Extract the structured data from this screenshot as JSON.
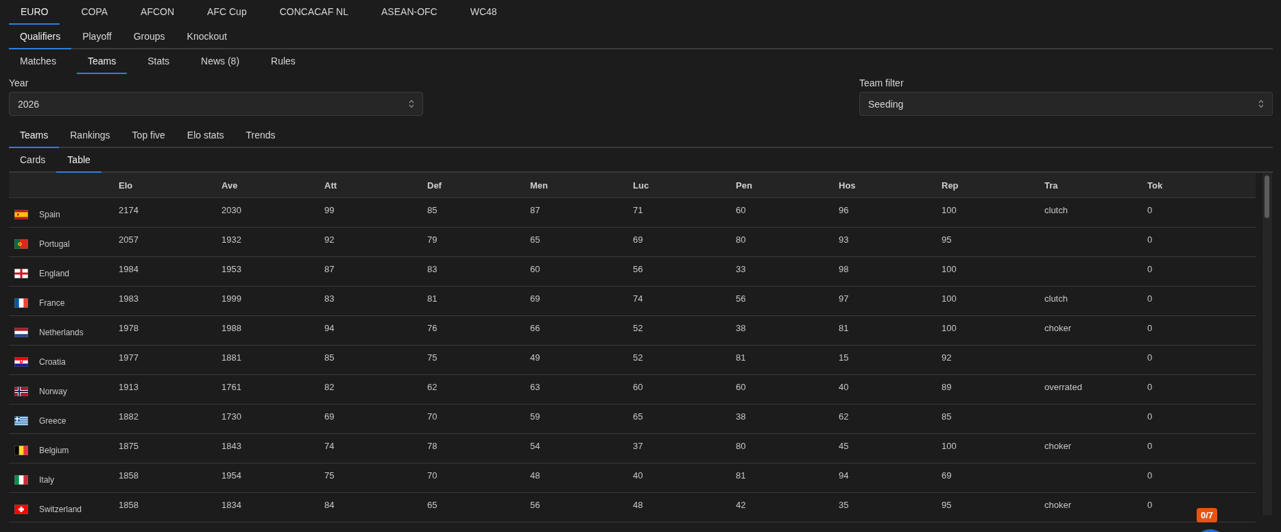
{
  "competition_tabs": [
    {
      "label": "EURO",
      "selected": true
    },
    {
      "label": "COPA",
      "selected": false
    },
    {
      "label": "AFCON",
      "selected": false
    },
    {
      "label": "AFC Cup",
      "selected": false
    },
    {
      "label": "CONCACAF NL",
      "selected": false
    },
    {
      "label": "ASEAN-OFC",
      "selected": false
    },
    {
      "label": "WC48",
      "selected": false
    }
  ],
  "stage_tabs": [
    {
      "label": "Qualifiers",
      "selected": true
    },
    {
      "label": "Playoff",
      "selected": false
    },
    {
      "label": "Groups",
      "selected": false
    },
    {
      "label": "Knockout",
      "selected": false
    }
  ],
  "section_tabs": [
    {
      "label": "Matches",
      "selected": false
    },
    {
      "label": "Teams",
      "selected": true
    },
    {
      "label": "Stats",
      "selected": false
    },
    {
      "label": "News (8)",
      "selected": false
    },
    {
      "label": "Rules",
      "selected": false
    }
  ],
  "filters": [
    {
      "label": "Year",
      "value": "2026"
    },
    {
      "label": "Team filter",
      "value": "Seeding"
    }
  ],
  "view_tabs": [
    {
      "label": "Teams",
      "selected": true
    },
    {
      "label": "Rankings",
      "selected": false
    },
    {
      "label": "Top five",
      "selected": false
    },
    {
      "label": "Elo stats",
      "selected": false
    },
    {
      "label": "Trends",
      "selected": false
    }
  ],
  "display_tabs": [
    {
      "label": "Cards",
      "selected": false
    },
    {
      "label": "Table",
      "selected": true
    }
  ],
  "table": {
    "columns": [
      "Elo",
      "Ave",
      "Att",
      "Def",
      "Men",
      "Luc",
      "Pen",
      "Hos",
      "Rep",
      "Tra",
      "Tok"
    ],
    "rows": [
      {
        "flag": {
          "kind": "es"
        },
        "team": "Spain",
        "cells": [
          "2174",
          "2030",
          "99",
          "85",
          "87",
          "71",
          "60",
          "96",
          "100",
          "clutch",
          "0"
        ]
      },
      {
        "flag": {
          "kind": "pt"
        },
        "team": "Portugal",
        "cells": [
          "2057",
          "1932",
          "92",
          "79",
          "65",
          "69",
          "80",
          "93",
          "95",
          "",
          "0"
        ]
      },
      {
        "flag": {
          "kind": "en"
        },
        "team": "England",
        "cells": [
          "1984",
          "1953",
          "87",
          "83",
          "60",
          "56",
          "33",
          "98",
          "100",
          "",
          "0"
        ]
      },
      {
        "flag": {
          "kind": "fr"
        },
        "team": "France",
        "cells": [
          "1983",
          "1999",
          "83",
          "81",
          "69",
          "74",
          "56",
          "97",
          "100",
          "clutch",
          "0"
        ]
      },
      {
        "flag": {
          "kind": "nl"
        },
        "team": "Netherlands",
        "cells": [
          "1978",
          "1988",
          "94",
          "76",
          "66",
          "52",
          "38",
          "81",
          "100",
          "choker",
          "0"
        ]
      },
      {
        "flag": {
          "kind": "hr"
        },
        "team": "Croatia",
        "cells": [
          "1977",
          "1881",
          "85",
          "75",
          "49",
          "52",
          "81",
          "15",
          "92",
          "",
          "0"
        ]
      },
      {
        "flag": {
          "kind": "no"
        },
        "team": "Norway",
        "cells": [
          "1913",
          "1761",
          "82",
          "62",
          "63",
          "60",
          "60",
          "40",
          "89",
          "overrated",
          "0"
        ]
      },
      {
        "flag": {
          "kind": "gr"
        },
        "team": "Greece",
        "cells": [
          "1882",
          "1730",
          "69",
          "70",
          "59",
          "65",
          "38",
          "62",
          "85",
          "",
          "0"
        ]
      },
      {
        "flag": {
          "kind": "be"
        },
        "team": "Belgium",
        "cells": [
          "1875",
          "1843",
          "74",
          "78",
          "54",
          "37",
          "80",
          "45",
          "100",
          "choker",
          "0"
        ]
      },
      {
        "flag": {
          "kind": "it"
        },
        "team": "Italy",
        "cells": [
          "1858",
          "1954",
          "75",
          "70",
          "48",
          "40",
          "81",
          "94",
          "69",
          "",
          "0"
        ]
      },
      {
        "flag": {
          "kind": "ch"
        },
        "team": "Switzerland",
        "cells": [
          "1858",
          "1834",
          "84",
          "65",
          "56",
          "48",
          "42",
          "35",
          "95",
          "choker",
          "0"
        ]
      }
    ]
  },
  "progress_badge": "0/7"
}
